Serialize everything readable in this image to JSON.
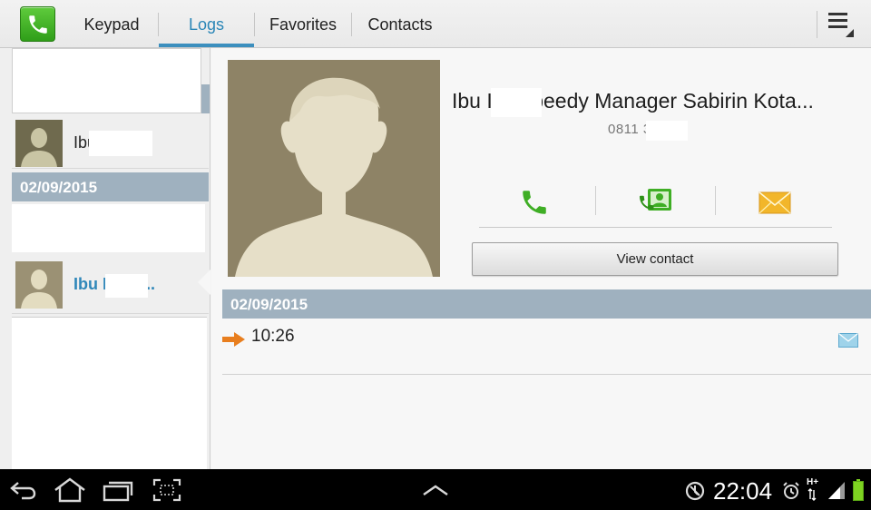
{
  "tabs": [
    {
      "label": "Keypad"
    },
    {
      "label": "Logs",
      "active": true
    },
    {
      "label": "Favorites"
    },
    {
      "label": "Contacts"
    }
  ],
  "log_list": {
    "entries": [
      {
        "name": "Ibu I     Spe..."
      },
      {
        "name": "Ibu I     Spe..."
      }
    ],
    "group_date": "02/09/2015"
  },
  "detail": {
    "contact_name": "Ibu I      K Speedy Manager Sabirin Kota...",
    "contact_number": "0811           34",
    "view_contact_label": "View contact",
    "log_date": "02/09/2015",
    "log_entries": [
      {
        "time": "10:26",
        "direction": "outgoing",
        "type_icon": "message-icon"
      }
    ]
  },
  "status_bar": {
    "time": "22:04",
    "network": "H+"
  },
  "colors": {
    "accent": "#2f87b9",
    "section_header": "#9fb1bf",
    "call_green": "#3fae25",
    "outgoing_arrow": "#e87e1e"
  }
}
